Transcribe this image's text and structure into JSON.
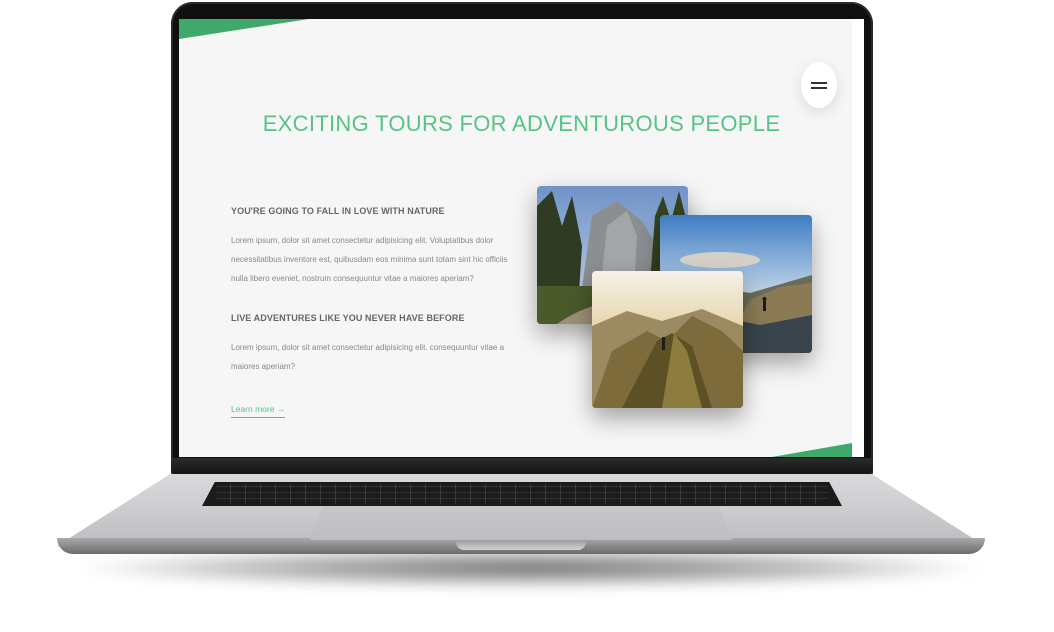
{
  "page": {
    "headline": "EXCITING TOURS FOR ADVENTUROUS PEOPLE",
    "sections": [
      {
        "heading": "YOU'RE GOING TO FALL IN LOVE WITH NATURE",
        "body": "Lorem ipsum, dolor sit amet consectetur adipisicing elit. Voluptatibus dolor necessitatibus inventore est, quibusdam eos minima sunt totam sint hic officiis nulla libero eveniet, nostrum consequuntur vitae a maiores aperiam?"
      },
      {
        "heading": "LIVE ADVENTURES LIKE YOU NEVER HAVE BEFORE",
        "body": "Lorem ipsum, dolor sit amet consectetur adipisicing elit. consequuntur vitae a maiores aperiam?"
      }
    ],
    "learn_more_label": "Learn more →",
    "menu_icon": "hamburger-menu-icon"
  },
  "colors": {
    "accent": "#55c485",
    "stripe": "#3fa96b",
    "background": "#f6f6f6",
    "heading_text": "#666666",
    "body_text": "#888888"
  },
  "photos": [
    {
      "subject": "forest-and-cliffs-photo"
    },
    {
      "subject": "hiker-on-coastal-hills-photo"
    },
    {
      "subject": "hiker-on-mountain-ridge-photo"
    }
  ]
}
